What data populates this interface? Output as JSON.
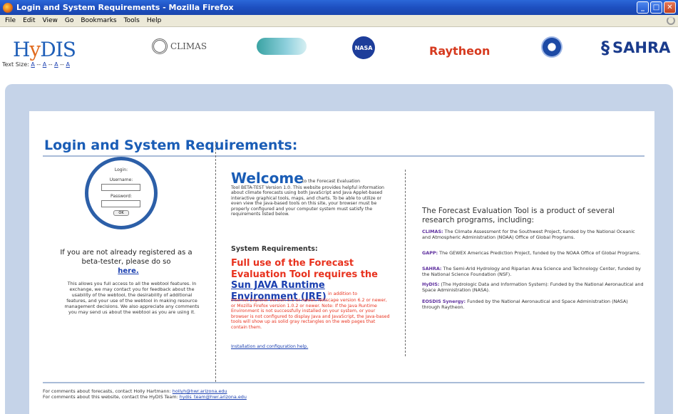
{
  "window": {
    "title": "Login and System Requirements - Mozilla Firefox"
  },
  "menu": [
    "File",
    "Edit",
    "View",
    "Go",
    "Bookmarks",
    "Tools",
    "Help"
  ],
  "logos": {
    "hydis_prefix": "H",
    "hydis_y": "y",
    "hydis_suffix": "DIS",
    "climas": "CLIMAS",
    "nasa": "NASA",
    "raytheon": "Raytheon",
    "sahra": "SAHRA"
  },
  "text_size": {
    "label": "Text Size:",
    "options": [
      "A",
      "A",
      "A",
      "A"
    ],
    "sep": "--"
  },
  "page": {
    "title": "Login and System Requirements:"
  },
  "login": {
    "heading": "Login:",
    "username_label": "Username:",
    "password_label": "Password:",
    "ok_label": "OK",
    "register_text": "If you are not already registered as a beta-tester, please do so",
    "register_link": "here.",
    "info": "This allows you full access to all the webtool features. In exchange, we may contact you for feedback about the usability of the webtool, the desirability of additional features, and your use of the webtool in making resource management decisions. We also appreciate any comments you may send us about the webtool as you are using it."
  },
  "welcome": {
    "heading": "Welcome",
    "intro": "to the Forecast Evaluation",
    "paragraph": "Tool BETA-TEST Version 1.0. This website provides helpful information about climate forecasts using both JavaScript and Java Applet-based interactive graphical tools, maps, and charts. To be able to utilize or even view the Java-based tools on this site, your browser must be properly configured and your computer system must satisfy the requirements listed below.",
    "sysreq_label": "System Requirements:",
    "full_use": "Full use of the Forecast Evaluation Tool requires the",
    "jre_link": "Sun JAVA Runtime Environment (JRE)",
    "jre_tail": "in addition to",
    "jre_para": "Internet Explorer version 5.5 or newer, Netscape version 6.2 or newer, or Mozilla Firefox version 1.0.2 or newer. Note: If the Java Runtime Environment is not successfully installed on your system, or your browser is not configured to display Java and JavaScript, the Java-based tools will show up as solid gray rectangles on the web pages that contain them.",
    "install_link": "Installation and configuration help."
  },
  "programs": {
    "heading": "The Forecast Evaluation Tool is a product of several research programs, including:",
    "items": [
      {
        "name": "CLIMAS:",
        "text": "The Climate Assessment for the Southwest Project, funded by the National Oceanic and Atmospheric Administration (NOAA) Office of Global Programs."
      },
      {
        "name": "GAPP:",
        "text": "The GEWEX Americas Prediction Project, funded by the NOAA Office of Global Programs."
      },
      {
        "name": "SAHRA:",
        "text": "The Semi-Arid Hydrology and Riparian Area Science and Technology Center, funded by the National Science Foundation (NSF)."
      },
      {
        "name": "HyDIS:",
        "text": "(The Hydrologic Data and Information System): Funded by the National Aeronautical and Space Administration (NASA)."
      },
      {
        "name": "EOSDIS Synergy:",
        "text": "Funded by the National Aeronautical and Space Administration (NASA) through Raytheon."
      }
    ]
  },
  "footer": {
    "forecasts_text": "For comments about forecasts, contact Holly Hartmann:",
    "forecasts_email": "hollyh@hwr.arizona.edu",
    "website_text": "For comments about this website, contact the HyDIS Team:",
    "website_email": "hydis_team@hwr.arizona.edu"
  }
}
